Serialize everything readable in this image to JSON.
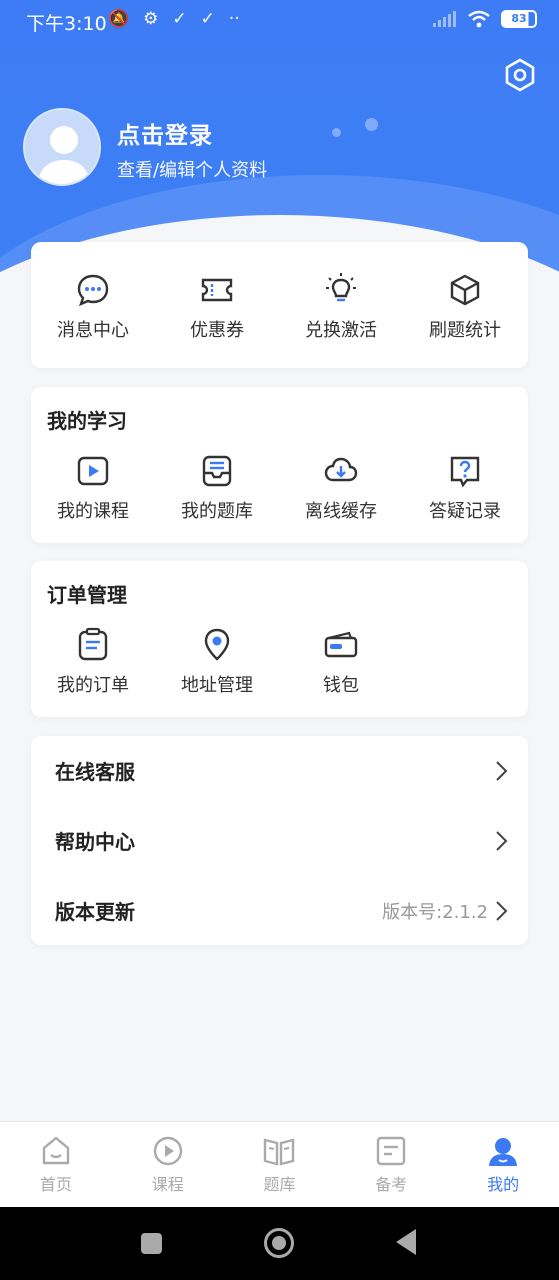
{
  "status_bar": {
    "time": "下午3:10",
    "battery": "83"
  },
  "profile": {
    "login_title": "点击登录",
    "login_subtitle": "查看/编辑个人资料"
  },
  "quick_actions": [
    {
      "label": "消息中心",
      "icon": "message-icon"
    },
    {
      "label": "优惠券",
      "icon": "coupon-icon"
    },
    {
      "label": "兑换激活",
      "icon": "lightbulb-icon"
    },
    {
      "label": "刷题统计",
      "icon": "cube-icon"
    }
  ],
  "my_study": {
    "title": "我的学习",
    "items": [
      {
        "label": "我的课程",
        "icon": "play-icon"
      },
      {
        "label": "我的题库",
        "icon": "inbox-icon"
      },
      {
        "label": "离线缓存",
        "icon": "cloud-download-icon"
      },
      {
        "label": "答疑记录",
        "icon": "question-icon"
      }
    ]
  },
  "orders": {
    "title": "订单管理",
    "items": [
      {
        "label": "我的订单",
        "icon": "clipboard-icon"
      },
      {
        "label": "地址管理",
        "icon": "location-icon"
      },
      {
        "label": "钱包",
        "icon": "wallet-icon"
      }
    ]
  },
  "menu": [
    {
      "label": "在线客服",
      "value": ""
    },
    {
      "label": "帮助中心",
      "value": ""
    },
    {
      "label": "版本更新",
      "value": "版本号:2.1.2"
    }
  ],
  "tabs": [
    {
      "label": "首页",
      "icon": "home-icon"
    },
    {
      "label": "课程",
      "icon": "play-circle-icon"
    },
    {
      "label": "题库",
      "icon": "book-icon"
    },
    {
      "label": "备考",
      "icon": "note-icon"
    },
    {
      "label": "我的",
      "icon": "user-icon",
      "active": true
    }
  ],
  "colors": {
    "primary": "#3b7af3",
    "text": "#222222",
    "muted": "#999999"
  }
}
